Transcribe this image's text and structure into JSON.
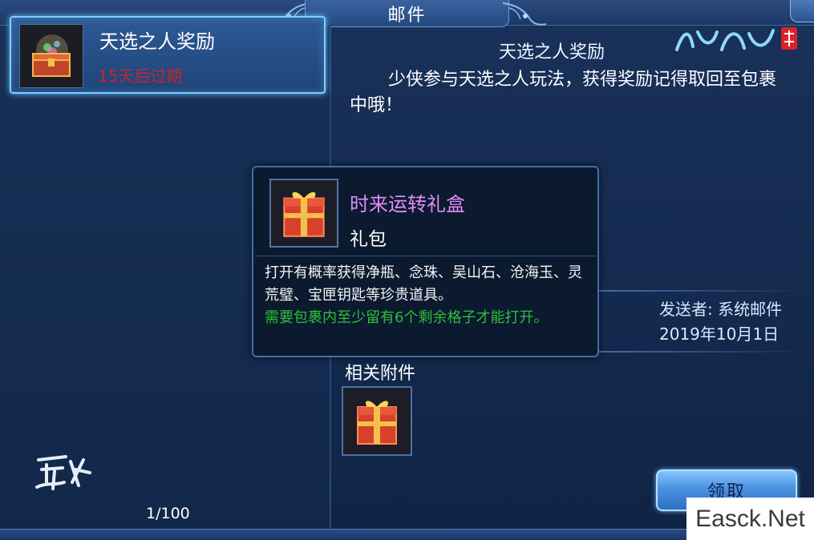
{
  "window": {
    "title": "邮件"
  },
  "mail_list": {
    "items": [
      {
        "title": "天选之人奖励",
        "expire": "15天后过期",
        "icon": "treasure-chest-icon"
      }
    ],
    "page_count": "1/100"
  },
  "mail": {
    "subject": "天选之人奖励",
    "body": "少侠参与天选之人玩法，获得奖励记得取回至包裹中哦！",
    "sender": "发送者: 系统邮件",
    "date": "2019年10月1日",
    "attachments_label": "相关附件",
    "claim_label": "领取"
  },
  "tooltip": {
    "item_name": "时来运转礼盒",
    "item_type": "礼包",
    "description": "打开有概率获得净瓶、念珠、吴山石、沧海玉、灵荒璧、宝匣钥匙等珍贵道具。",
    "note": "需要包裹内至少留有6个剩余格子才能打开。",
    "icon": "gift-box-icon"
  },
  "watermark": "Easck.Net",
  "colors": {
    "accent": "#7ad0ff",
    "expire_text": "#c7262a",
    "item_name": "#e38cf5",
    "note_text": "#2fbf3a"
  }
}
